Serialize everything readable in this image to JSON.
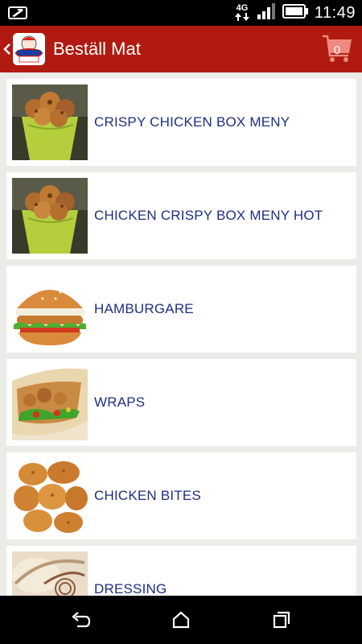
{
  "status_bar": {
    "time": "11:49",
    "network": "4G",
    "icons": [
      "notification-icon",
      "data-arrows-icon",
      "signal-icon",
      "battery-icon"
    ]
  },
  "app_bar": {
    "title": "Beställ Mat",
    "logo_icon": "chicken-logo-icon",
    "cart_count": "0",
    "colors": {
      "background": "#b01a10",
      "cart": "#f08a80"
    }
  },
  "menu": {
    "items": [
      {
        "label": "CRISPY CHICKEN BOX MENY",
        "image": "crispy-chicken-box-image"
      },
      {
        "label": "CHICKEN CRISPY BOX MENY HOT",
        "image": "crispy-chicken-box-hot-image"
      },
      {
        "label": "HAMBURGARE",
        "image": "hamburger-image"
      },
      {
        "label": "WRAPS",
        "image": "wrap-image"
      },
      {
        "label": "CHICKEN BITES",
        "image": "chicken-bites-image"
      },
      {
        "label": "DRESSING",
        "image": "dressing-image"
      }
    ],
    "colors": {
      "label": "#1f2f80",
      "background": "#ebebe8"
    }
  },
  "nav_bar": {
    "buttons": [
      "back-icon",
      "home-icon",
      "recents-icon"
    ]
  }
}
